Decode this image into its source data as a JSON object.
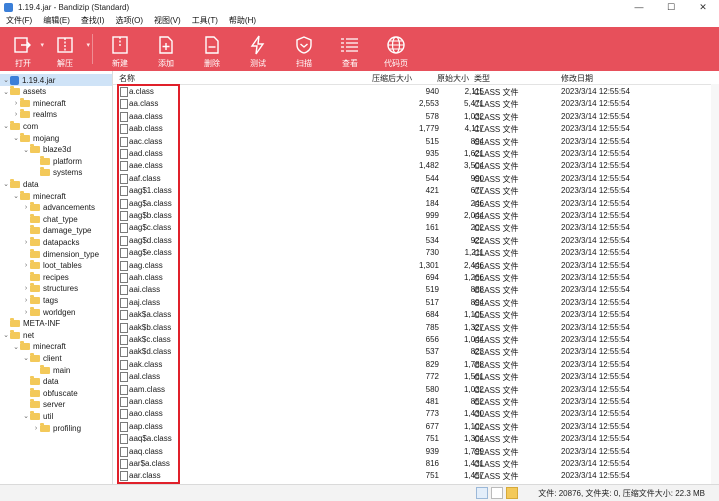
{
  "window": {
    "title": "1.19.4.jar - Bandizip (Standard)"
  },
  "menu": [
    "文件(F)",
    "编辑(E)",
    "查找(I)",
    "选项(O)",
    "视图(V)",
    "工具(T)",
    "帮助(H)"
  ],
  "toolbar": [
    {
      "label": "打开",
      "icon": "open-icon"
    },
    {
      "label": "解压",
      "icon": "extract-icon"
    },
    {
      "label": "新建",
      "icon": "new-archive-icon"
    },
    {
      "label": "添加",
      "icon": "add-icon"
    },
    {
      "label": "删除",
      "icon": "delete-icon"
    },
    {
      "label": "测试",
      "icon": "test-icon"
    },
    {
      "label": "扫描",
      "icon": "scan-icon"
    },
    {
      "label": "查看",
      "icon": "view-icon"
    },
    {
      "label": "代码页",
      "icon": "codepage-icon"
    }
  ],
  "tree": [
    {
      "label": "1.19.4.jar",
      "level": 0,
      "type": "archive",
      "expanded": true,
      "selected": true
    },
    {
      "label": "assets",
      "level": 0,
      "type": "folder",
      "expanded": true
    },
    {
      "label": "minecraft",
      "level": 1,
      "type": "folder",
      "expanded": false
    },
    {
      "label": "realms",
      "level": 1,
      "type": "folder",
      "expanded": false
    },
    {
      "label": "com",
      "level": 0,
      "type": "folder",
      "expanded": true
    },
    {
      "label": "mojang",
      "level": 1,
      "type": "folder",
      "expanded": true
    },
    {
      "label": "blaze3d",
      "level": 2,
      "type": "folder",
      "expanded": true
    },
    {
      "label": "platform",
      "level": 3,
      "type": "folder",
      "leaf": true
    },
    {
      "label": "systems",
      "level": 3,
      "type": "folder",
      "leaf": true
    },
    {
      "label": "data",
      "level": 0,
      "type": "folder",
      "expanded": true
    },
    {
      "label": "minecraft",
      "level": 1,
      "type": "folder",
      "expanded": true
    },
    {
      "label": "advancements",
      "level": 2,
      "type": "folder",
      "expanded": false
    },
    {
      "label": "chat_type",
      "level": 2,
      "type": "folder",
      "leaf": true
    },
    {
      "label": "damage_type",
      "level": 2,
      "type": "folder",
      "leaf": true
    },
    {
      "label": "datapacks",
      "level": 2,
      "type": "folder",
      "expanded": false
    },
    {
      "label": "dimension_type",
      "level": 2,
      "type": "folder",
      "leaf": true
    },
    {
      "label": "loot_tables",
      "level": 2,
      "type": "folder",
      "expanded": false
    },
    {
      "label": "recipes",
      "level": 2,
      "type": "folder",
      "leaf": true
    },
    {
      "label": "structures",
      "level": 2,
      "type": "folder",
      "expanded": false
    },
    {
      "label": "tags",
      "level": 2,
      "type": "folder",
      "expanded": false
    },
    {
      "label": "worldgen",
      "level": 2,
      "type": "folder",
      "expanded": false
    },
    {
      "label": "META-INF",
      "level": 0,
      "type": "folder",
      "leaf": true
    },
    {
      "label": "net",
      "level": 0,
      "type": "folder",
      "expanded": true
    },
    {
      "label": "minecraft",
      "level": 1,
      "type": "folder",
      "expanded": true
    },
    {
      "label": "client",
      "level": 2,
      "type": "folder",
      "expanded": true
    },
    {
      "label": "main",
      "level": 3,
      "type": "folder",
      "leaf": true
    },
    {
      "label": "data",
      "level": 2,
      "type": "folder",
      "leaf": true
    },
    {
      "label": "obfuscate",
      "level": 2,
      "type": "folder",
      "leaf": true
    },
    {
      "label": "server",
      "level": 2,
      "type": "folder",
      "leaf": true
    },
    {
      "label": "util",
      "level": 2,
      "type": "folder",
      "expanded": true
    },
    {
      "label": "profiling",
      "level": 3,
      "type": "folder",
      "expanded": false
    }
  ],
  "columns": {
    "name": "名称",
    "compressed": "压缩后大小",
    "original": "原始大小",
    "type": "类型",
    "modified": "修改日期"
  },
  "files": [
    {
      "name": "a.class",
      "compressed": "940",
      "original": "2,115",
      "type": "CLASS 文件",
      "modified": "2023/3/14 12:55:54"
    },
    {
      "name": "aa.class",
      "compressed": "2,553",
      "original": "5,471",
      "type": "CLASS 文件",
      "modified": "2023/3/14 12:55:54"
    },
    {
      "name": "aaa.class",
      "compressed": "578",
      "original": "1,032",
      "type": "CLASS 文件",
      "modified": "2023/3/14 12:55:54"
    },
    {
      "name": "aab.class",
      "compressed": "1,779",
      "original": "4,117",
      "type": "CLASS 文件",
      "modified": "2023/3/14 12:55:54"
    },
    {
      "name": "aac.class",
      "compressed": "515",
      "original": "894",
      "type": "CLASS 文件",
      "modified": "2023/3/14 12:55:54"
    },
    {
      "name": "aad.class",
      "compressed": "935",
      "original": "1,621",
      "type": "CLASS 文件",
      "modified": "2023/3/14 12:55:54"
    },
    {
      "name": "aae.class",
      "compressed": "1,482",
      "original": "3,504",
      "type": "CLASS 文件",
      "modified": "2023/3/14 12:55:54"
    },
    {
      "name": "aaf.class",
      "compressed": "544",
      "original": "990",
      "type": "CLASS 文件",
      "modified": "2023/3/14 12:55:54"
    },
    {
      "name": "aag$1.class",
      "compressed": "421",
      "original": "677",
      "type": "CLASS 文件",
      "modified": "2023/3/14 12:55:54"
    },
    {
      "name": "aag$a.class",
      "compressed": "184",
      "original": "246",
      "type": "CLASS 文件",
      "modified": "2023/3/14 12:55:54"
    },
    {
      "name": "aag$b.class",
      "compressed": "999",
      "original": "2,044",
      "type": "CLASS 文件",
      "modified": "2023/3/14 12:55:54"
    },
    {
      "name": "aag$c.class",
      "compressed": "161",
      "original": "202",
      "type": "CLASS 文件",
      "modified": "2023/3/14 12:55:54"
    },
    {
      "name": "aag$d.class",
      "compressed": "534",
      "original": "922",
      "type": "CLASS 文件",
      "modified": "2023/3/14 12:55:54"
    },
    {
      "name": "aag$e.class",
      "compressed": "730",
      "original": "1,211",
      "type": "CLASS 文件",
      "modified": "2023/3/14 12:55:54"
    },
    {
      "name": "aag.class",
      "compressed": "1,301",
      "original": "2,446",
      "type": "CLASS 文件",
      "modified": "2023/3/14 12:55:54"
    },
    {
      "name": "aah.class",
      "compressed": "694",
      "original": "1,266",
      "type": "CLASS 文件",
      "modified": "2023/3/14 12:55:54"
    },
    {
      "name": "aai.class",
      "compressed": "519",
      "original": "888",
      "type": "CLASS 文件",
      "modified": "2023/3/14 12:55:54"
    },
    {
      "name": "aaj.class",
      "compressed": "517",
      "original": "894",
      "type": "CLASS 文件",
      "modified": "2023/3/14 12:55:54"
    },
    {
      "name": "aak$a.class",
      "compressed": "684",
      "original": "1,105",
      "type": "CLASS 文件",
      "modified": "2023/3/14 12:55:54"
    },
    {
      "name": "aak$b.class",
      "compressed": "785",
      "original": "1,327",
      "type": "CLASS 文件",
      "modified": "2023/3/14 12:55:54"
    },
    {
      "name": "aak$c.class",
      "compressed": "656",
      "original": "1,044",
      "type": "CLASS 文件",
      "modified": "2023/3/14 12:55:54"
    },
    {
      "name": "aak$d.class",
      "compressed": "537",
      "original": "823",
      "type": "CLASS 文件",
      "modified": "2023/3/14 12:55:54"
    },
    {
      "name": "aak.class",
      "compressed": "829",
      "original": "1,788",
      "type": "CLASS 文件",
      "modified": "2023/3/14 12:55:54"
    },
    {
      "name": "aal.class",
      "compressed": "772",
      "original": "1,561",
      "type": "CLASS 文件",
      "modified": "2023/3/14 12:55:54"
    },
    {
      "name": "aam.class",
      "compressed": "580",
      "original": "1,032",
      "type": "CLASS 文件",
      "modified": "2023/3/14 12:55:54"
    },
    {
      "name": "aan.class",
      "compressed": "481",
      "original": "852",
      "type": "CLASS 文件",
      "modified": "2023/3/14 12:55:54"
    },
    {
      "name": "aao.class",
      "compressed": "773",
      "original": "1,430",
      "type": "CLASS 文件",
      "modified": "2023/3/14 12:55:54"
    },
    {
      "name": "aap.class",
      "compressed": "677",
      "original": "1,102",
      "type": "CLASS 文件",
      "modified": "2023/3/14 12:55:54"
    },
    {
      "name": "aaq$a.class",
      "compressed": "751",
      "original": "1,304",
      "type": "CLASS 文件",
      "modified": "2023/3/14 12:55:54"
    },
    {
      "name": "aaq.class",
      "compressed": "939",
      "original": "1,799",
      "type": "CLASS 文件",
      "modified": "2023/3/14 12:55:54"
    },
    {
      "name": "aar$a.class",
      "compressed": "816",
      "original": "1,431",
      "type": "CLASS 文件",
      "modified": "2023/3/14 12:55:54"
    },
    {
      "name": "aar.class",
      "compressed": "751",
      "original": "1,457",
      "type": "CLASS 文件",
      "modified": "2023/3/14 12:55:54"
    }
  ],
  "status": {
    "text": "文件: 20876, 文件夹: 0, 压缩文件大小: 22.3 MB"
  },
  "colors": {
    "toolbar_bg": "#e7505b",
    "highlight_box": "#e0202a",
    "folder": "#f3c95a",
    "selection": "#cfe3f7"
  }
}
